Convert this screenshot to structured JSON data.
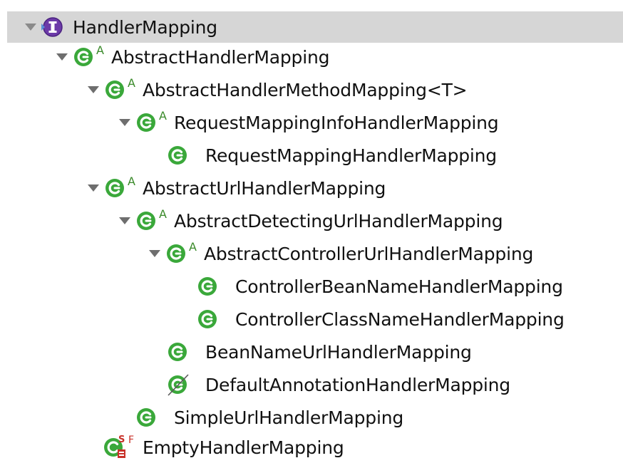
{
  "tree": {
    "root": {
      "label": "HandlerMapping",
      "kind": "interface"
    },
    "items": [
      {
        "label": "AbstractHandlerMapping",
        "kind": "abstract-class"
      },
      {
        "label": "AbstractHandlerMethodMapping<T>",
        "kind": "abstract-class"
      },
      {
        "label": "RequestMappingInfoHandlerMapping",
        "kind": "abstract-class"
      },
      {
        "label": "RequestMappingHandlerMapping",
        "kind": "class"
      },
      {
        "label": "AbstractUrlHandlerMapping",
        "kind": "abstract-class"
      },
      {
        "label": "AbstractDetectingUrlHandlerMapping",
        "kind": "abstract-class"
      },
      {
        "label": "AbstractControllerUrlHandlerMapping",
        "kind": "abstract-class"
      },
      {
        "label": "ControllerBeanNameHandlerMapping",
        "kind": "class"
      },
      {
        "label": "ControllerClassNameHandlerMapping",
        "kind": "class"
      },
      {
        "label": "BeanNameUrlHandlerMapping",
        "kind": "class"
      },
      {
        "label": "DefaultAnnotationHandlerMapping",
        "kind": "deprecated-class"
      },
      {
        "label": "SimpleUrlHandlerMapping",
        "kind": "class"
      },
      {
        "label": "EmptyHandlerMapping",
        "kind": "static-final-class"
      }
    ],
    "abstract_mark": "A",
    "static_mark": "S",
    "final_mark": "F"
  },
  "colors": {
    "class_green": "#3aa83a",
    "interface_purple": "#7a3fb0",
    "selection_bg": "#d6d6d6",
    "arrow_gray": "#6e6e6e"
  }
}
